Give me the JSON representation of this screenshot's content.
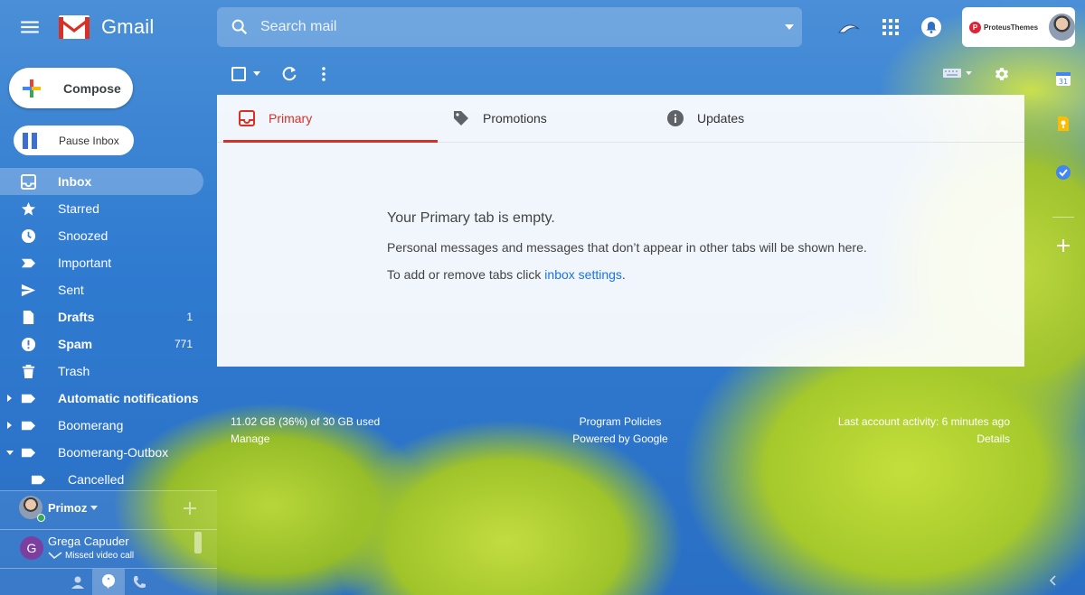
{
  "app": {
    "name": "Gmail"
  },
  "search": {
    "placeholder": "Search mail"
  },
  "account": {
    "brand": "ProteusThemes",
    "brand_color": "#e02235"
  },
  "compose": {
    "label": "Compose"
  },
  "pause": {
    "label": "Pause Inbox"
  },
  "nav": {
    "items": [
      {
        "label": "Inbox",
        "count": ""
      },
      {
        "label": "Starred",
        "count": ""
      },
      {
        "label": "Snoozed",
        "count": ""
      },
      {
        "label": "Important",
        "count": ""
      },
      {
        "label": "Sent",
        "count": ""
      },
      {
        "label": "Drafts",
        "count": "1"
      },
      {
        "label": "Spam",
        "count": "771"
      },
      {
        "label": "Trash",
        "count": ""
      },
      {
        "label": "Automatic notifications",
        "count": ""
      },
      {
        "label": "Boomerang",
        "count": ""
      },
      {
        "label": "Boomerang-Outbox",
        "count": ""
      },
      {
        "label": "Cancelled",
        "count": ""
      }
    ]
  },
  "hangouts": {
    "self_name": "Primoz",
    "contact": {
      "initial": "G",
      "name": "Grega Capuder",
      "status": "Missed video call"
    }
  },
  "tabs": [
    {
      "label": "Primary"
    },
    {
      "label": "Promotions"
    },
    {
      "label": "Updates"
    }
  ],
  "empty_state": {
    "title": "Your Primary tab is empty.",
    "line1": "Personal messages and messages that don’t appear in other tabs will be shown here.",
    "line2_prefix": "To add or remove tabs click ",
    "line2_link": "inbox settings",
    "line2_suffix": "."
  },
  "footer": {
    "storage": "11.02 GB (36%) of 30 GB used",
    "manage": "Manage",
    "policies": "Program Policies",
    "powered": "Powered by Google",
    "activity": "Last account activity: 6 minutes ago",
    "details": "Details"
  },
  "colors": {
    "accent": "#d93025",
    "link": "#1a73e8"
  }
}
